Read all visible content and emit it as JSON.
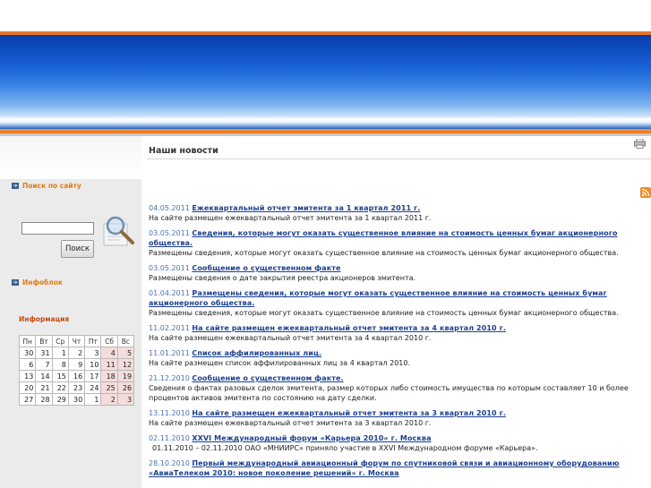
{
  "sidebar": {
    "search_title": "Поиск по сайту",
    "search_value": "",
    "search_button": "Поиск",
    "infoblock_title": "Инфоблок",
    "info_title": "Информация",
    "calendar": {
      "headers": [
        "Пн",
        "Вт",
        "Ср",
        "Чт",
        "Пт",
        "Сб",
        "Вс"
      ],
      "weeks": [
        [
          "30",
          "31",
          "1",
          "2",
          "3",
          "4",
          "5"
        ],
        [
          "6",
          "7",
          "8",
          "9",
          "10",
          "11",
          "12"
        ],
        [
          "13",
          "14",
          "15",
          "16",
          "17",
          "18",
          "19"
        ],
        [
          "20",
          "21",
          "22",
          "23",
          "24",
          "25",
          "26"
        ],
        [
          "27",
          "28",
          "29",
          "30",
          "1",
          "2",
          "3"
        ]
      ]
    }
  },
  "main": {
    "page_title": "Наши новости",
    "news": [
      {
        "date": "04.05.2011",
        "title": "Ежеквартальный отчет эмитента за 1 квартал 2011 г.",
        "desc": "На сайте размещен ежеквартальный отчет эмитента за 1 квартал 2011 г."
      },
      {
        "date": "03.05.2011",
        "title": "Сведения, которые могут оказать существенное влияние на стоимость ценных бумаг акционерного общества.",
        "desc": "Размещены сведения, которые могут оказать существенное влияние на стоимость ценных бумаг акционерного общества."
      },
      {
        "date": "03.05.2011",
        "title": "Сообщение о существенном факте",
        "desc": "Размещены сведения о дате закрытия реестра акционеров эмитента."
      },
      {
        "date": "01.04.2011",
        "title": "Размещены сведения, которые могут оказать существенное влияние на стоимость ценных бумаг акционерного общества.",
        "desc": "Размещены сведения, которые могут оказать существенное влияние на стоимость ценных бумаг акционерного общества."
      },
      {
        "date": "11.02.2011",
        "title": "На сайте размещен ежеквартальный отчет эмитента за 4 квартал 2010 г.",
        "desc": "На сайте размещен ежеквартальный отчет эмитента за 4 квартал 2010 г."
      },
      {
        "date": "11.01.2011",
        "title": "Список аффилированных лиц.",
        "desc": "На сайте размещен список аффилированных лиц за 4 квартал 2010."
      },
      {
        "date": "21.12.2010",
        "title": "Сообщение о существенном факте.",
        "desc": "Сведения о фактах разовых сделок эмитента, размер которых либо стоимость имущества по которым составляет 10 и более процентов активов эмитента по состоянию на дату сделки."
      },
      {
        "date": "13.11.2010",
        "title": "На сайте размещен ежеквартальный отчет эмитента за 3 квартал 2010 г.",
        "desc": "На сайте размещен ежеквартальный отчет эмитента за 3 квартал 2010 г."
      },
      {
        "date": "02.11.2010",
        "title": "XXVI Международный форум «Карьера 2010» г. Москва",
        "desc": "01.11.2010 – 02.11.2010 ОАО «МНИИРС» приняло участие в XXVI Международном форуме «Карьера»."
      },
      {
        "date": "28.10.2010",
        "title": "Первый международный авиационный форум по спутниковой связи и авиационному оборудованию «АвиаТелеком 2010: новое поколение решений» г. Москва",
        "desc": ""
      }
    ]
  }
}
